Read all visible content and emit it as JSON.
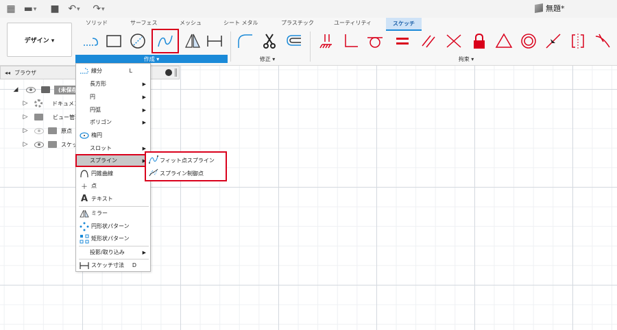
{
  "topbar": {
    "grid_icon": "grid-icon",
    "file_icon": "file-icon",
    "save_icon": "save-icon",
    "undo_icon": "undo-icon",
    "redo_icon": "redo-icon",
    "doc_title": "無題*"
  },
  "ribbon": {
    "tabs": [
      {
        "label": "ソリッド",
        "active": false
      },
      {
        "label": "サーフェス",
        "active": false
      },
      {
        "label": "メッシュ",
        "active": false
      },
      {
        "label": "シート メタル",
        "active": false
      },
      {
        "label": "プラスチック",
        "active": false
      },
      {
        "label": "ユーティリティ",
        "active": false
      },
      {
        "label": "スケッチ",
        "active": true
      }
    ],
    "workspace_label": "デザイン ▾",
    "panels": {
      "create": "作成 ▾",
      "modify": "修正 ▾",
      "constraints": "拘束 ▾"
    }
  },
  "browser": {
    "title": "ブラウザ",
    "items": [
      {
        "label": "(未保存)",
        "icon": "document-icon"
      },
      {
        "label": "ドキュメント",
        "icon": "gear-icon"
      },
      {
        "label": "ビュー管理",
        "icon": "folder-icon"
      },
      {
        "label": "原点",
        "icon": "folder-icon"
      },
      {
        "label": "スケッチ",
        "icon": "folder-icon"
      }
    ]
  },
  "menu": {
    "items": [
      {
        "label": "線分",
        "shortcut": "L",
        "icon": "line-icon",
        "submenu": false
      },
      {
        "label": "長方形",
        "submenu": true
      },
      {
        "label": "円",
        "submenu": true
      },
      {
        "label": "円弧",
        "submenu": true
      },
      {
        "label": "ポリゴン",
        "submenu": true
      },
      {
        "label": "楕円",
        "icon": "ellipse-icon",
        "submenu": false
      },
      {
        "label": "スロット",
        "submenu": true
      },
      {
        "label": "スプライン",
        "submenu": true,
        "selected": true
      },
      {
        "label": "円錐曲線",
        "icon": "conic-icon",
        "submenu": false
      },
      {
        "label": "点",
        "icon": "point-icon",
        "submenu": false
      },
      {
        "label": "テキスト",
        "icon": "text-icon",
        "submenu": false
      },
      {
        "label": "ミラー",
        "icon": "mirror-icon",
        "submenu": false
      },
      {
        "label": "円形状パターン",
        "icon": "circular-pattern-icon",
        "submenu": false
      },
      {
        "label": "矩形状パターン",
        "icon": "rectangular-pattern-icon",
        "submenu": false
      },
      {
        "label": "投影/取り込み",
        "submenu": true
      },
      {
        "label": "スケッチ寸法",
        "shortcut": "D",
        "icon": "dimension-icon",
        "submenu": false
      }
    ]
  },
  "submenu": {
    "items": [
      {
        "label": "フィット点スプライン",
        "icon": "fit-point-spline-icon"
      },
      {
        "label": "スプライン制御点",
        "icon": "control-point-spline-icon"
      }
    ]
  },
  "colors": {
    "accent_blue": "#1b8ad8",
    "highlight_red": "#d9001b",
    "constraint_red": "#d9001b"
  }
}
